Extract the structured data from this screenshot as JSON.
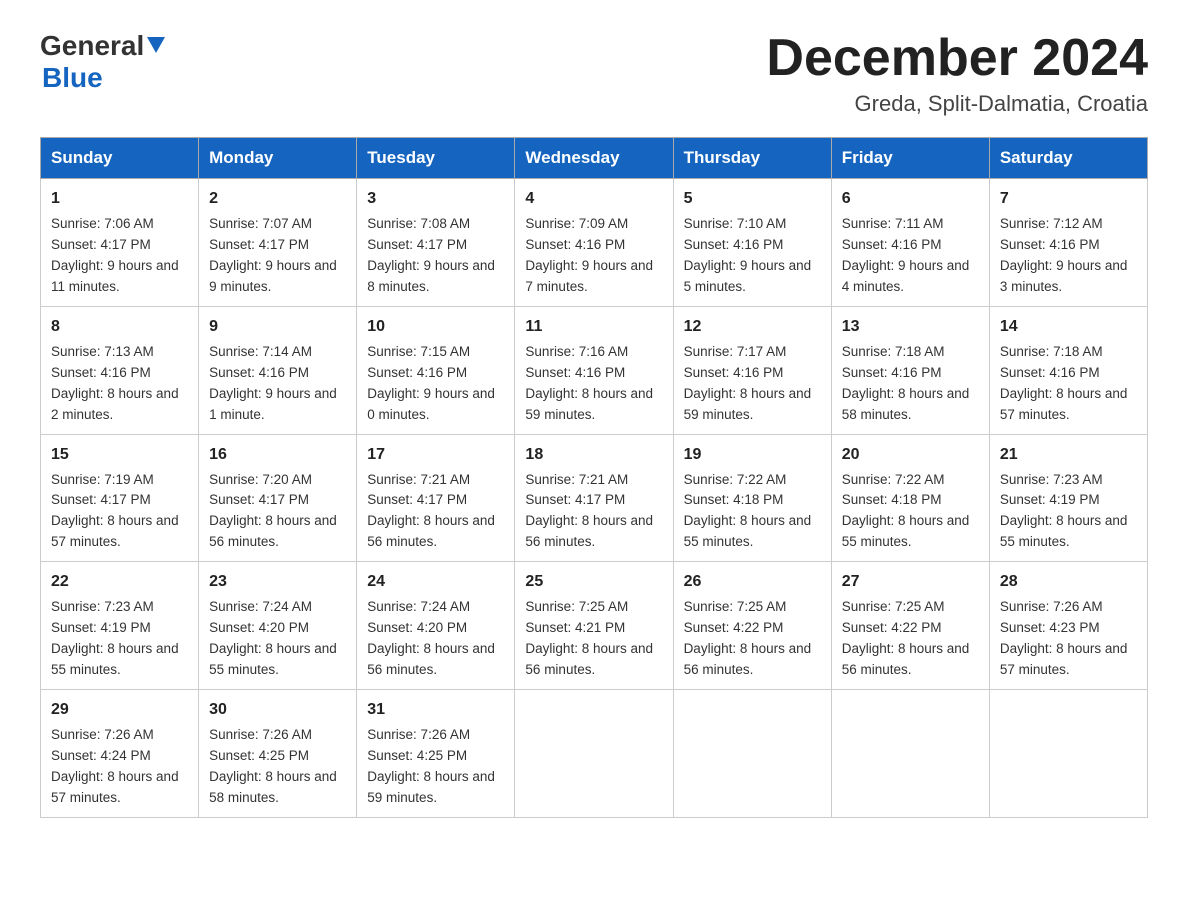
{
  "header": {
    "logo_line1": "General",
    "logo_line2": "Blue",
    "month_title": "December 2024",
    "location": "Greda, Split-Dalmatia, Croatia"
  },
  "days_of_week": [
    "Sunday",
    "Monday",
    "Tuesday",
    "Wednesday",
    "Thursday",
    "Friday",
    "Saturday"
  ],
  "weeks": [
    [
      {
        "day": "1",
        "sunrise": "7:06 AM",
        "sunset": "4:17 PM",
        "daylight": "9 hours and 11 minutes."
      },
      {
        "day": "2",
        "sunrise": "7:07 AM",
        "sunset": "4:17 PM",
        "daylight": "9 hours and 9 minutes."
      },
      {
        "day": "3",
        "sunrise": "7:08 AM",
        "sunset": "4:17 PM",
        "daylight": "9 hours and 8 minutes."
      },
      {
        "day": "4",
        "sunrise": "7:09 AM",
        "sunset": "4:16 PM",
        "daylight": "9 hours and 7 minutes."
      },
      {
        "day": "5",
        "sunrise": "7:10 AM",
        "sunset": "4:16 PM",
        "daylight": "9 hours and 5 minutes."
      },
      {
        "day": "6",
        "sunrise": "7:11 AM",
        "sunset": "4:16 PM",
        "daylight": "9 hours and 4 minutes."
      },
      {
        "day": "7",
        "sunrise": "7:12 AM",
        "sunset": "4:16 PM",
        "daylight": "9 hours and 3 minutes."
      }
    ],
    [
      {
        "day": "8",
        "sunrise": "7:13 AM",
        "sunset": "4:16 PM",
        "daylight": "8 hours and 2 minutes."
      },
      {
        "day": "9",
        "sunrise": "7:14 AM",
        "sunset": "4:16 PM",
        "daylight": "9 hours and 1 minute."
      },
      {
        "day": "10",
        "sunrise": "7:15 AM",
        "sunset": "4:16 PM",
        "daylight": "9 hours and 0 minutes."
      },
      {
        "day": "11",
        "sunrise": "7:16 AM",
        "sunset": "4:16 PM",
        "daylight": "8 hours and 59 minutes."
      },
      {
        "day": "12",
        "sunrise": "7:17 AM",
        "sunset": "4:16 PM",
        "daylight": "8 hours and 59 minutes."
      },
      {
        "day": "13",
        "sunrise": "7:18 AM",
        "sunset": "4:16 PM",
        "daylight": "8 hours and 58 minutes."
      },
      {
        "day": "14",
        "sunrise": "7:18 AM",
        "sunset": "4:16 PM",
        "daylight": "8 hours and 57 minutes."
      }
    ],
    [
      {
        "day": "15",
        "sunrise": "7:19 AM",
        "sunset": "4:17 PM",
        "daylight": "8 hours and 57 minutes."
      },
      {
        "day": "16",
        "sunrise": "7:20 AM",
        "sunset": "4:17 PM",
        "daylight": "8 hours and 56 minutes."
      },
      {
        "day": "17",
        "sunrise": "7:21 AM",
        "sunset": "4:17 PM",
        "daylight": "8 hours and 56 minutes."
      },
      {
        "day": "18",
        "sunrise": "7:21 AM",
        "sunset": "4:17 PM",
        "daylight": "8 hours and 56 minutes."
      },
      {
        "day": "19",
        "sunrise": "7:22 AM",
        "sunset": "4:18 PM",
        "daylight": "8 hours and 55 minutes."
      },
      {
        "day": "20",
        "sunrise": "7:22 AM",
        "sunset": "4:18 PM",
        "daylight": "8 hours and 55 minutes."
      },
      {
        "day": "21",
        "sunrise": "7:23 AM",
        "sunset": "4:19 PM",
        "daylight": "8 hours and 55 minutes."
      }
    ],
    [
      {
        "day": "22",
        "sunrise": "7:23 AM",
        "sunset": "4:19 PM",
        "daylight": "8 hours and 55 minutes."
      },
      {
        "day": "23",
        "sunrise": "7:24 AM",
        "sunset": "4:20 PM",
        "daylight": "8 hours and 55 minutes."
      },
      {
        "day": "24",
        "sunrise": "7:24 AM",
        "sunset": "4:20 PM",
        "daylight": "8 hours and 56 minutes."
      },
      {
        "day": "25",
        "sunrise": "7:25 AM",
        "sunset": "4:21 PM",
        "daylight": "8 hours and 56 minutes."
      },
      {
        "day": "26",
        "sunrise": "7:25 AM",
        "sunset": "4:22 PM",
        "daylight": "8 hours and 56 minutes."
      },
      {
        "day": "27",
        "sunrise": "7:25 AM",
        "sunset": "4:22 PM",
        "daylight": "8 hours and 56 minutes."
      },
      {
        "day": "28",
        "sunrise": "7:26 AM",
        "sunset": "4:23 PM",
        "daylight": "8 hours and 57 minutes."
      }
    ],
    [
      {
        "day": "29",
        "sunrise": "7:26 AM",
        "sunset": "4:24 PM",
        "daylight": "8 hours and 57 minutes."
      },
      {
        "day": "30",
        "sunrise": "7:26 AM",
        "sunset": "4:25 PM",
        "daylight": "8 hours and 58 minutes."
      },
      {
        "day": "31",
        "sunrise": "7:26 AM",
        "sunset": "4:25 PM",
        "daylight": "8 hours and 59 minutes."
      },
      null,
      null,
      null,
      null
    ]
  ],
  "labels": {
    "sunrise": "Sunrise:",
    "sunset": "Sunset:",
    "daylight": "Daylight:"
  }
}
